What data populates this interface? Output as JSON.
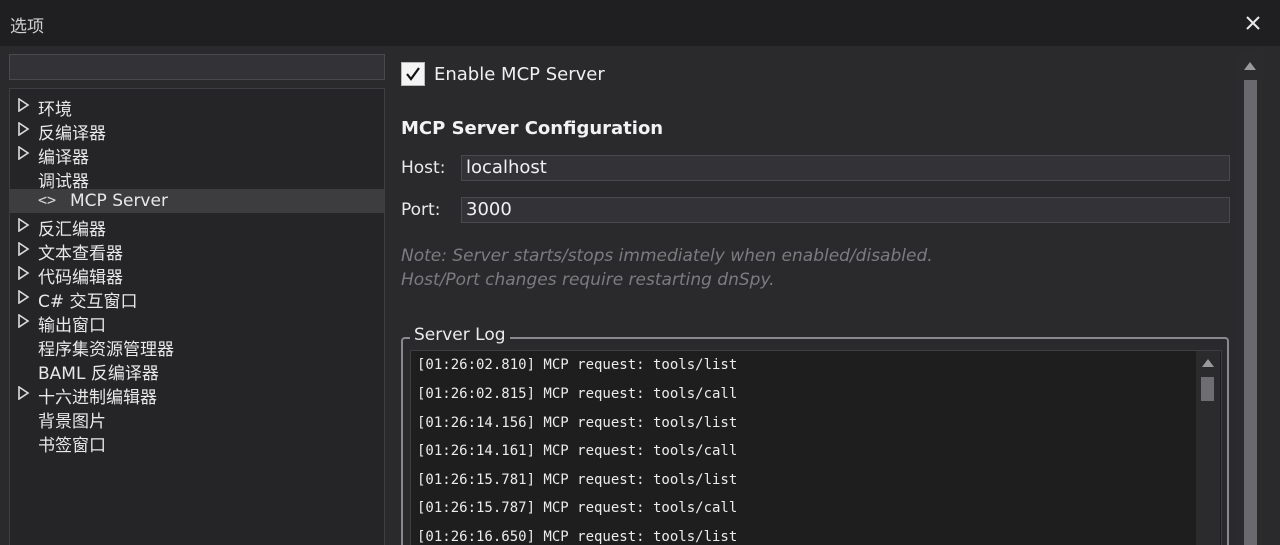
{
  "window": {
    "title": "选项"
  },
  "close_icon": "close-icon",
  "search": {
    "value": ""
  },
  "tree": {
    "items": [
      {
        "label": "环境",
        "expandable": true
      },
      {
        "label": "反编译器",
        "expandable": true
      },
      {
        "label": "编译器",
        "expandable": true
      },
      {
        "label": "调试器",
        "expandable": false
      },
      {
        "label": "MCP Server",
        "expandable": false,
        "selected": true,
        "icon": "code-icon",
        "icon_text": "<>"
      },
      {
        "label": "反汇编器",
        "expandable": true
      },
      {
        "label": "文本查看器",
        "expandable": true
      },
      {
        "label": "代码编辑器",
        "expandable": true
      },
      {
        "label": "C# 交互窗口",
        "expandable": true
      },
      {
        "label": "输出窗口",
        "expandable": true
      },
      {
        "label": "程序集资源管理器",
        "expandable": false
      },
      {
        "label": "BAML 反编译器",
        "expandable": false
      },
      {
        "label": "十六进制编辑器",
        "expandable": true
      },
      {
        "label": "背景图片",
        "expandable": false
      },
      {
        "label": "书签窗口",
        "expandable": false
      }
    ]
  },
  "settings": {
    "enable_label": "Enable MCP Server",
    "enabled": true,
    "section_title": "MCP Server Configuration",
    "host_label": "Host:",
    "host_value": "localhost",
    "port_label": "Port:",
    "port_value": "3000",
    "note_line1": "Note: Server starts/stops immediately when enabled/disabled.",
    "note_line2": "Host/Port changes require restarting dnSpy."
  },
  "log": {
    "title": "Server Log",
    "lines": [
      "[01:26:02.810] MCP request: tools/list",
      "[01:26:02.815] MCP request: tools/call",
      "[01:26:14.156] MCP request: tools/list",
      "[01:26:14.161] MCP request: tools/call",
      "[01:26:15.781] MCP request: tools/list",
      "[01:26:15.787] MCP request: tools/call",
      "[01:26:16.650] MCP request: tools/list"
    ]
  },
  "colors": {
    "background": "#2a2a2c",
    "titlebar": "#1f1f21",
    "selected_row": "#3d3d40",
    "note_text": "#7c7c80",
    "log_background": "#1e1e1e"
  }
}
